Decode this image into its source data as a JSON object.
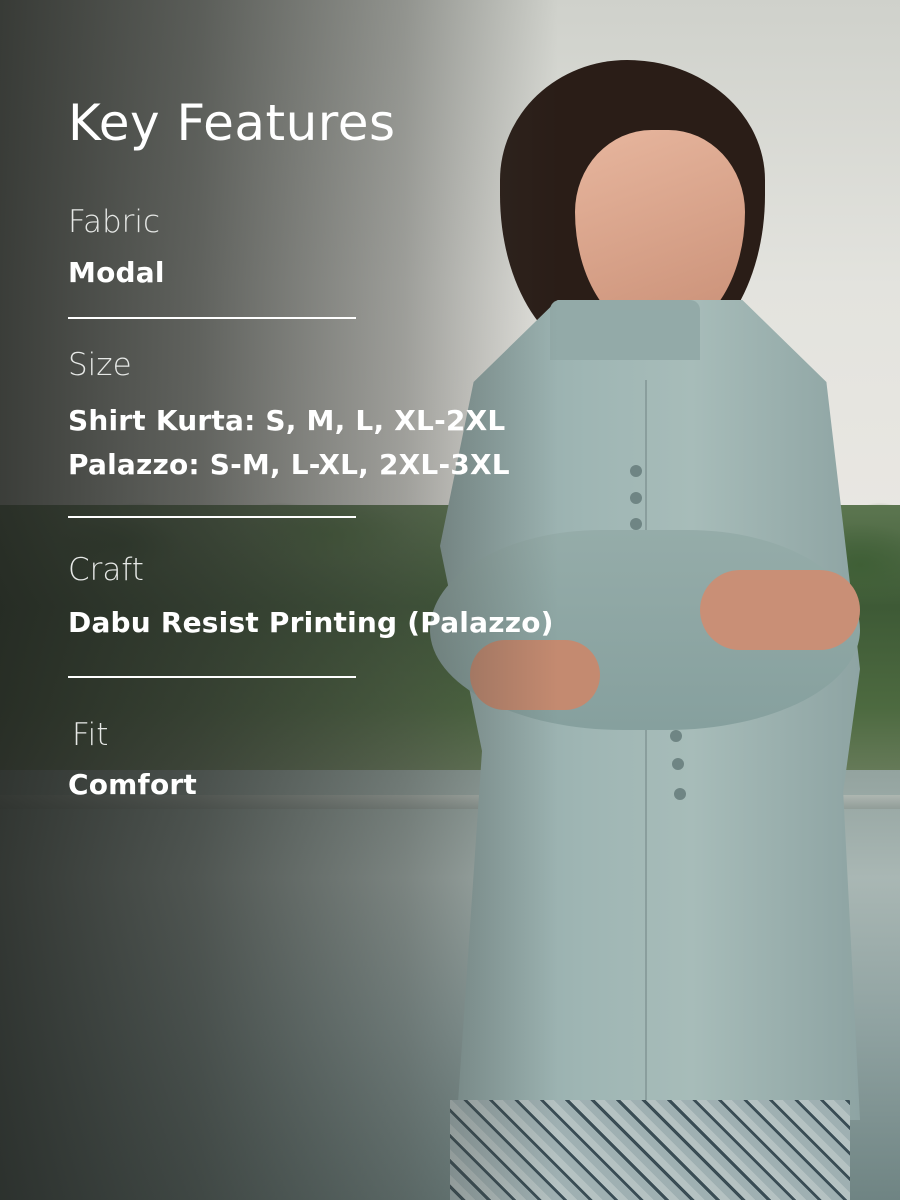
{
  "title": "Key Features",
  "features": [
    {
      "label": "Fabric",
      "values": [
        "Modal"
      ]
    },
    {
      "label": "Size",
      "values": [
        "Shirt Kurta: S, M, L, XL-2XL",
        "Palazzo: S-M, L-XL, 2XL-3XL"
      ]
    },
    {
      "label": "Craft",
      "values": [
        "Dabu Resist Printing (Palazzo)"
      ]
    },
    {
      "label": "Fit",
      "values": [
        "Comfort"
      ]
    }
  ],
  "colors": {
    "text": "#ffffff",
    "label_text": "#e6e8e6",
    "garment": "#9fb6b4"
  }
}
